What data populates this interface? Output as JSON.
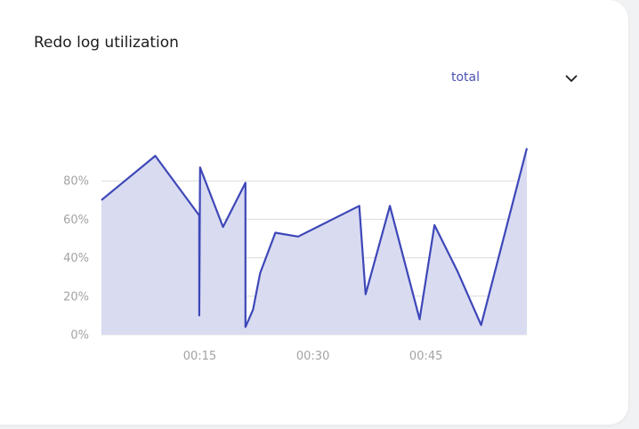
{
  "card": {
    "title": "Redo log utilization"
  },
  "selector": {
    "value": "total",
    "icon": "chevron-down-icon"
  },
  "colors": {
    "line": "#3d47b8",
    "fill": "#d9dbf1",
    "grid": "#dcdcdc",
    "ticks": "#a3a3a3"
  },
  "chart_data": {
    "type": "area",
    "title": "Redo log utilization",
    "xlabel": "",
    "ylabel": "",
    "ylim": [
      0,
      100
    ],
    "xlim_seconds": [
      0,
      3450
    ],
    "grid": true,
    "yticks": [
      {
        "value": 0,
        "label": "0%"
      },
      {
        "value": 20,
        "label": "20%"
      },
      {
        "value": 40,
        "label": "40%"
      },
      {
        "value": 60,
        "label": "60%"
      },
      {
        "value": 80,
        "label": "80%"
      }
    ],
    "xticks": [
      {
        "value": 797,
        "label": "00:15"
      },
      {
        "value": 1715,
        "label": "00:30"
      },
      {
        "value": 2632,
        "label": "00:45"
      }
    ],
    "series": [
      {
        "values_x": [
          0,
          437,
          793,
          793,
          800,
          986,
          1168,
          1168,
          1229,
          1287,
          1410,
          1595,
          2091,
          2142,
          2339,
          2580,
          2701,
          2887,
          3079,
          3450
        ],
        "values_y": [
          70,
          93,
          62,
          10,
          87,
          56,
          79,
          4,
          13,
          32,
          53,
          51,
          67,
          21,
          67,
          8,
          57,
          33,
          5,
          97
        ]
      }
    ]
  }
}
